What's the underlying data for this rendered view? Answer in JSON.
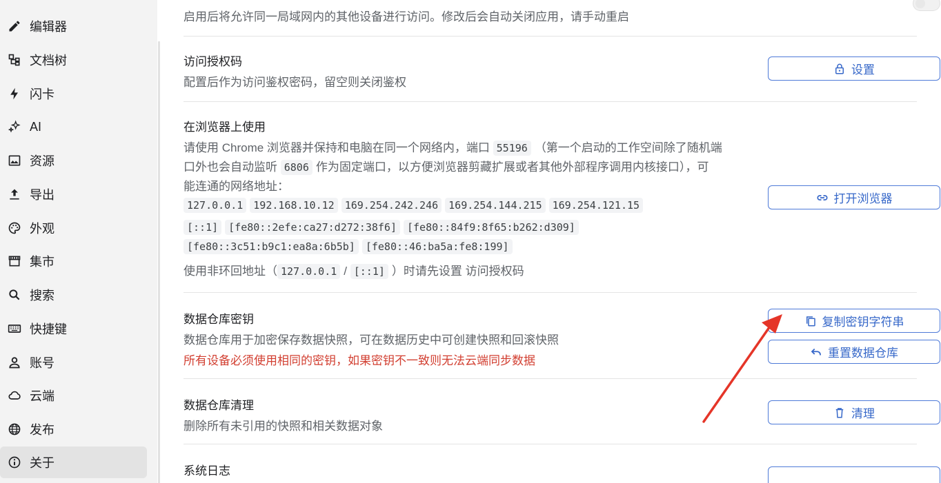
{
  "sidebar": {
    "items": [
      {
        "label": "编辑器",
        "icon": "pencil-icon"
      },
      {
        "label": "文档树",
        "icon": "tree-icon"
      },
      {
        "label": "闪卡",
        "icon": "lightning-icon"
      },
      {
        "label": "AI",
        "icon": "sparkle-icon"
      },
      {
        "label": "资源",
        "icon": "image-icon"
      },
      {
        "label": "导出",
        "icon": "upload-icon"
      },
      {
        "label": "外观",
        "icon": "palette-icon"
      },
      {
        "label": "集市",
        "icon": "store-icon"
      },
      {
        "label": "搜索",
        "icon": "search-icon"
      },
      {
        "label": "快捷键",
        "icon": "keyboard-icon"
      },
      {
        "label": "账号",
        "icon": "person-icon"
      },
      {
        "label": "云端",
        "icon": "cloud-icon"
      },
      {
        "label": "发布",
        "icon": "globe-icon"
      },
      {
        "label": "关于",
        "icon": "info-icon"
      }
    ],
    "active": "关于"
  },
  "sections": {
    "lan": {
      "desc": "启用后将允许同一局域网内的其他设备进行访问。修改后会自动关闭应用，请手动重启",
      "toggle_on": false
    },
    "auth": {
      "title": "访问授权码",
      "desc": "配置后作为访问鉴权密码，留空则关闭鉴权",
      "button": "设置"
    },
    "browser": {
      "title": "在浏览器上使用",
      "desc_1a": "请使用 Chrome 浏览器并保持和电脑在同一个网络内，端口",
      "port_random": "55196",
      "desc_1b": "（第一个启动的工作空间除了随机端",
      "desc_2a": "口外也会自动监听",
      "port_fixed": "6806",
      "desc_2b": "作为固定端口，以方便浏览器剪藏扩展或者其他外部程序调用内核接口），可",
      "desc_3": "能连通的网络地址：",
      "addresses_v4": [
        "127.0.0.1",
        "192.168.10.12",
        "169.254.242.246",
        "169.254.144.215",
        "169.254.121.15"
      ],
      "addresses_v6_row1": [
        "[::1]",
        "[fe80::2efe:ca27:d272:38f6]",
        "[fe80::84f9:8f65:b262:d309]"
      ],
      "addresses_v6_row2": [
        "[fe80::3c51:b9c1:ea8a:6b5b]",
        "[fe80::46:ba5a:fe8:199]"
      ],
      "note_a": "使用非环回地址（",
      "note_loop_v4": "127.0.0.1",
      "note_sep": "/",
      "note_loop_v6": "[::1]",
      "note_b": "）时请先设置 访问授权码",
      "button": "打开浏览器"
    },
    "repo_key": {
      "title": "数据仓库密钥",
      "desc": "数据仓库用于加密保存数据快照，可在数据历史中可创建快照和回滚快照",
      "warn": "所有设备必须使用相同的密钥，如果密钥不一致则无法云端同步数据",
      "button_copy": "复制密钥字符串",
      "button_reset": "重置数据仓库"
    },
    "repo_purge": {
      "title": "数据仓库清理",
      "desc": "删除所有未引用的快照和相关数据对象",
      "button": "清理"
    },
    "syslog": {
      "title": "系统日志"
    }
  },
  "colors": {
    "accent": "#3768c9",
    "warning": "#d23f31",
    "annotation_arrow": "#e53528"
  }
}
